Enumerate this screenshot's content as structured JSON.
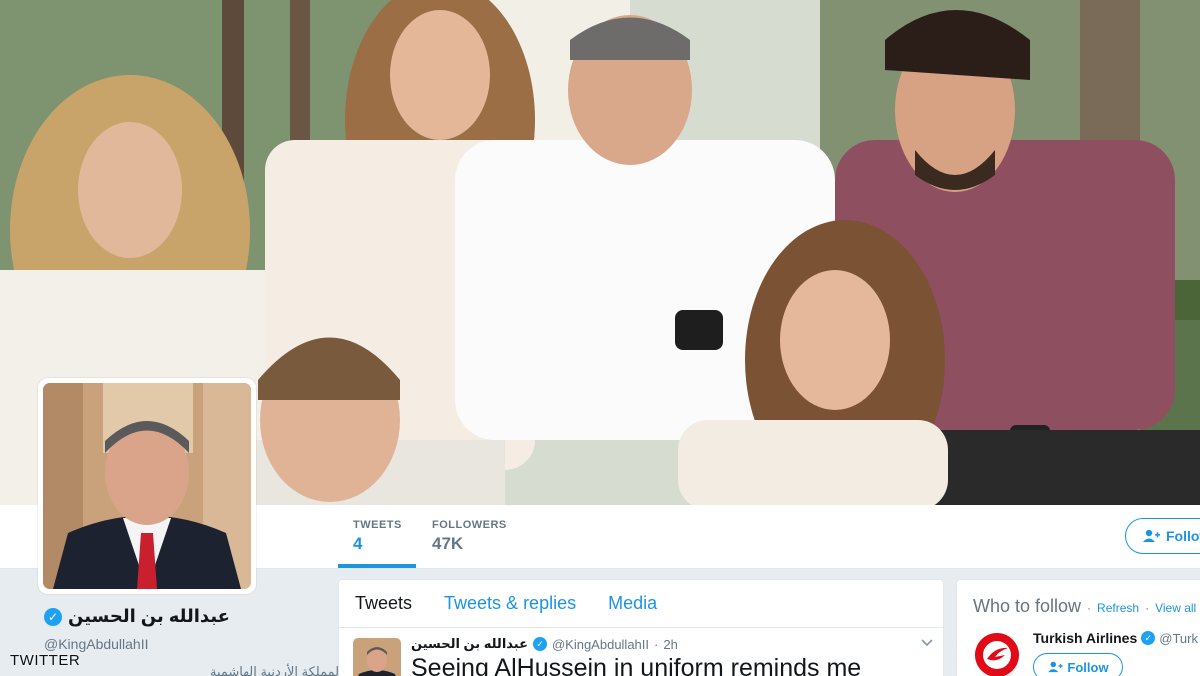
{
  "profile": {
    "name": "عبدالله بن الحسين",
    "handle": "@KingAbdullahII",
    "bio": "عبدالله بن الحسين، ملك المملكة الأردنية الهاشمية"
  },
  "stats": [
    {
      "label": "TWEETS",
      "value": "4"
    },
    {
      "label": "FOLLOWERS",
      "value": "47K"
    }
  ],
  "follow_button": {
    "label": "Follow"
  },
  "timeline": {
    "tabs": [
      "Tweets",
      "Tweets & replies",
      "Media"
    ],
    "active_tab": "Tweets",
    "tweet": {
      "author_name": "عبدالله بن الحسين",
      "author_handle": "@KingAbdullahII",
      "time": "2h",
      "separator": "·",
      "text": "Seeing AlHussein in uniform reminds me"
    }
  },
  "who_to_follow": {
    "title": "Who to follow",
    "refresh": "Refresh",
    "view_all": "View all",
    "separator": "·",
    "suggestion": {
      "name": "Turkish Airlines",
      "handle": "@Turk",
      "follow_label": "Follow"
    }
  },
  "watermark": "TWITTER",
  "colors": {
    "accent": "#1b95e0",
    "verified": "#1da1f2",
    "brand_turkish": "#e30a17",
    "page_bg": "#e6ecf0"
  },
  "icons": {
    "verified": "verified-badge-icon",
    "follow": "add-user-icon",
    "chevron": "chevron-down-icon"
  }
}
